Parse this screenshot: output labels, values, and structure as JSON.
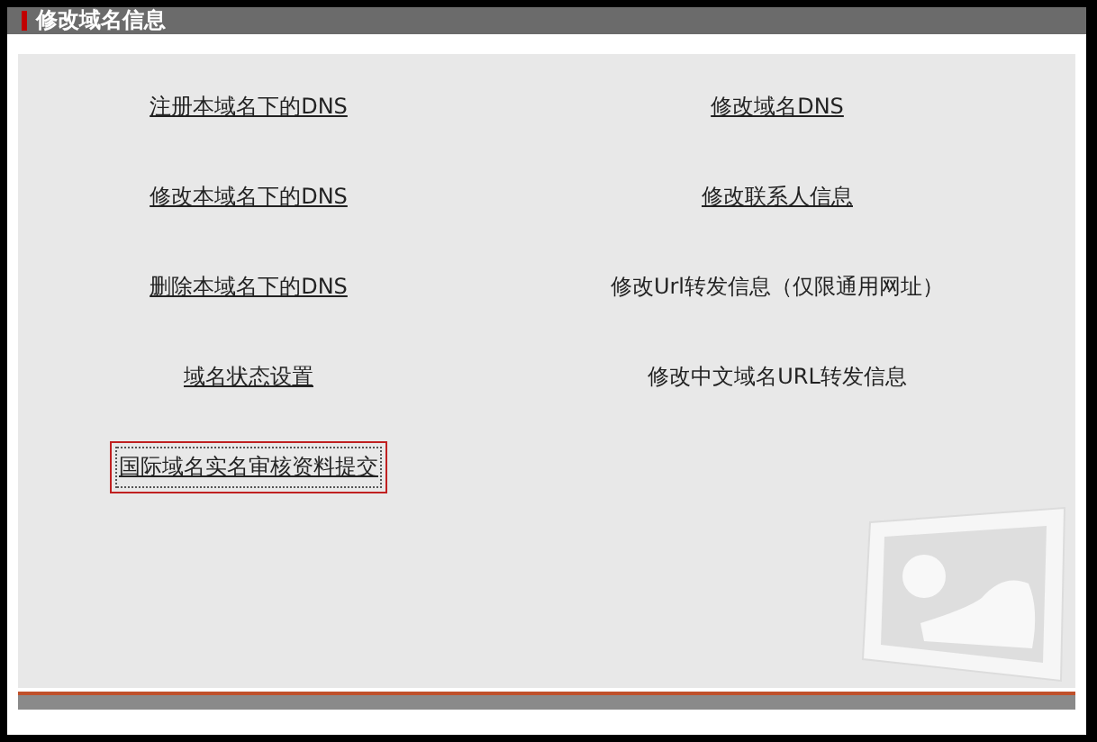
{
  "header": {
    "title": "修改域名信息"
  },
  "items": [
    {
      "label": "注册本域名下的DNS",
      "kind": "link",
      "focused": false
    },
    {
      "label": "修改域名DNS",
      "kind": "link",
      "focused": false
    },
    {
      "label": "修改本域名下的DNS",
      "kind": "link",
      "focused": false
    },
    {
      "label": "修改联系人信息",
      "kind": "link",
      "focused": false
    },
    {
      "label": "删除本域名下的DNS",
      "kind": "link",
      "focused": false
    },
    {
      "label": "修改Url转发信息（仅限通用网址）",
      "kind": "text",
      "focused": false
    },
    {
      "label": "域名状态设置",
      "kind": "link",
      "focused": false
    },
    {
      "label": "修改中文域名URL转发信息",
      "kind": "text",
      "focused": false
    },
    {
      "label": "国际域名实名审核资料提交",
      "kind": "link",
      "focused": true
    }
  ]
}
